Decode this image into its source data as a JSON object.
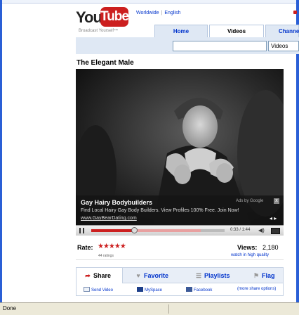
{
  "header": {
    "logo_you": "You",
    "logo_tube": "Tube",
    "tagline": "Broadcast Yourself™",
    "links": [
      "Worldwide",
      "English"
    ]
  },
  "nav": {
    "tabs": [
      {
        "label": "Home",
        "active": false
      },
      {
        "label": "Videos",
        "active": true
      },
      {
        "label": "Channe",
        "active": false
      }
    ]
  },
  "search": {
    "query": "",
    "scope": "Videos"
  },
  "video": {
    "title": "The Elegant Male"
  },
  "ad": {
    "title": "Gay Hairy Bodybuilders",
    "description": "Find Local Hairy Gay Body Builders. View Profiles 100% Free. Join Now!",
    "link": "www.GayBearDating.com",
    "attribution": "Ads by Google",
    "close": "x",
    "arrows": "◂ ▸"
  },
  "player": {
    "time": "0:33 / 1:44",
    "progress": 0.32,
    "buffered": 0.82
  },
  "stats": {
    "rate_label": "Rate:",
    "stars": "★★★★★",
    "rating": 4.5,
    "ratings_count": "44 ratings",
    "views_label": "Views:",
    "views_value": "2,180",
    "hq_link": "watch in high quality"
  },
  "actions": {
    "tabs": [
      {
        "label": "Share",
        "icon": "share-icon",
        "active": true
      },
      {
        "label": "Favorite",
        "icon": "heart-icon",
        "active": false
      },
      {
        "label": "Playlists",
        "icon": "playlist-icon",
        "active": false
      },
      {
        "label": "Flag",
        "icon": "flag-icon",
        "active": false
      }
    ],
    "share_links": [
      {
        "label": "Send Video",
        "icon": "envelope-icon"
      },
      {
        "label": "MySpace",
        "icon": "myspace-icon"
      },
      {
        "label": "Facebook",
        "icon": "facebook-icon"
      },
      {
        "label": "(more share options)",
        "icon": ""
      }
    ]
  },
  "status_bar": {
    "text": "Done"
  },
  "colors": {
    "brand_red": "#cc1f1f",
    "link_blue": "#0033cc",
    "nav_bg": "#dfe8f4",
    "window_blue": "#2a5fd6"
  }
}
